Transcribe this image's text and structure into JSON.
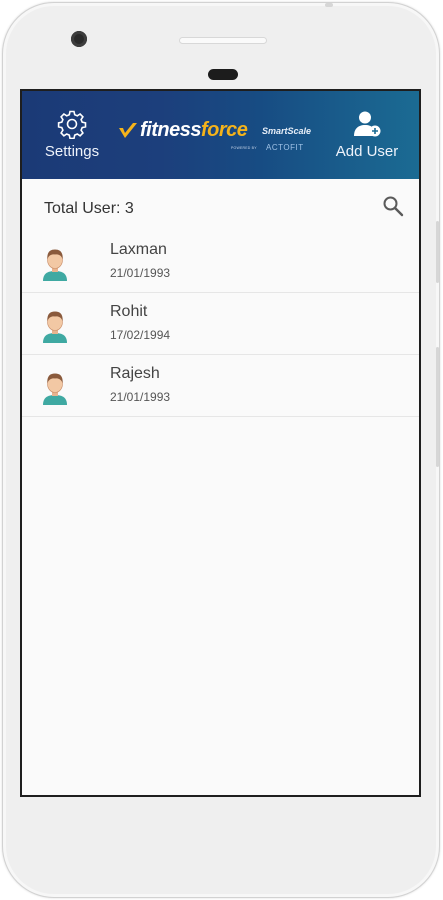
{
  "header": {
    "settings_label": "Settings",
    "add_user_label": "Add User",
    "logo": {
      "word_fitness": "fitness",
      "word_force": "force",
      "sub": "SmartScale",
      "powered": "POWERED BY",
      "partner": "ACTOFIT"
    }
  },
  "summary": {
    "total_label": "Total User: 3"
  },
  "users": [
    {
      "name": "Laxman",
      "dob": "21/01/1993"
    },
    {
      "name": "Rohit",
      "dob": "17/02/1994"
    },
    {
      "name": "Rajesh",
      "dob": "21/01/1993"
    }
  ],
  "colors": {
    "header_start": "#1b3a76",
    "header_end": "#1b6b93",
    "logo_accent": "#f5b31a",
    "avatar_shirt": "#3fa9a2",
    "avatar_hair": "#8a5a3c"
  },
  "icons": {
    "settings": "gear-icon",
    "add_user": "add-user-icon",
    "search": "search-icon",
    "avatar": "avatar-icon"
  }
}
